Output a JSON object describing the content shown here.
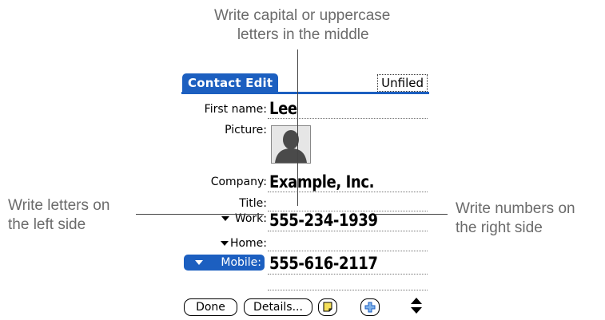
{
  "callouts": {
    "top_line1": "Write capital or uppercase",
    "top_line2": "letters in the middle",
    "left_line1": "Write letters on",
    "left_line2": "the left side",
    "right_line1": "Write numbers on",
    "right_line2": "the right side"
  },
  "app": {
    "title": "Contact Edit",
    "category": "Unfiled"
  },
  "fields": {
    "first_name": {
      "label": "First name:",
      "value": "Lee"
    },
    "picture": {
      "label": "Picture:"
    },
    "company": {
      "label": "Company:",
      "value": "Example, Inc."
    },
    "title": {
      "label": "Title:",
      "value": ""
    },
    "work": {
      "label": "Work:",
      "value": "555-234-1939"
    },
    "home": {
      "label": "Home:",
      "value": ""
    },
    "mobile": {
      "label": "Mobile:",
      "value": "555-616-2117"
    }
  },
  "buttons": {
    "done": "Done",
    "details": "Details..."
  },
  "icons": {
    "note": "note-icon",
    "add": "plus-icon",
    "scroll": "scroll-arrows-icon",
    "avatar": "person-silhouette-icon",
    "accent": "#1c5fc0",
    "note_color": "#f5e05a"
  }
}
